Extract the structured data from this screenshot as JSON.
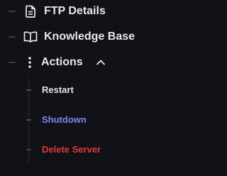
{
  "nav": {
    "items": [
      {
        "label": "FTP Details",
        "icon": "file-text-icon"
      },
      {
        "label": "Knowledge Base",
        "icon": "book-icon"
      },
      {
        "label": "Actions",
        "icon": "vertical-dots-icon",
        "expanded": true,
        "toggle_icon": "chevron-up-icon"
      }
    ],
    "actions": [
      {
        "label": "Restart",
        "color": "#e3e4e8"
      },
      {
        "label": "Shutdown",
        "color": "#7f84f5"
      },
      {
        "label": "Delete Server",
        "color": "#e2383c"
      }
    ]
  },
  "colors": {
    "background": "#111217",
    "text": "#e6e7ea",
    "tick": "#3a3d48",
    "tree_line": "#2c2f38"
  }
}
